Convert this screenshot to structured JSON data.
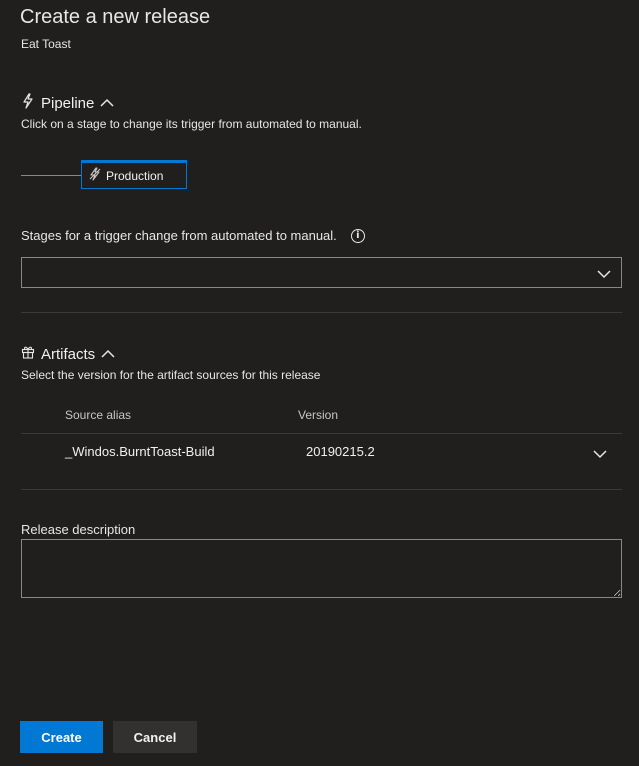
{
  "header": {
    "title": "Create a new release",
    "subtitle": "Eat Toast"
  },
  "pipeline": {
    "heading": "Pipeline",
    "description": "Click on a stage to change its trigger from automated to manual.",
    "stage_label": "Production",
    "icon": "lightning-icon"
  },
  "trigger_change": {
    "label": "Stages for a trigger change from automated to manual.",
    "value": ""
  },
  "artifacts": {
    "heading": "Artifacts",
    "description": "Select the version for the artifact sources for this release",
    "columns": [
      "Source alias",
      "Version"
    ],
    "rows": [
      {
        "alias": "_Windos.BurntToast-Build",
        "version": "20190215.2"
      }
    ],
    "icon": "gift-icon"
  },
  "release_description": {
    "label": "Release description",
    "value": ""
  },
  "actions": {
    "create_label": "Create",
    "cancel_label": "Cancel"
  },
  "colors": {
    "background": "#201f1e",
    "accent": "#0078d4",
    "border": "#8a8886",
    "divider": "#3b3a39"
  }
}
